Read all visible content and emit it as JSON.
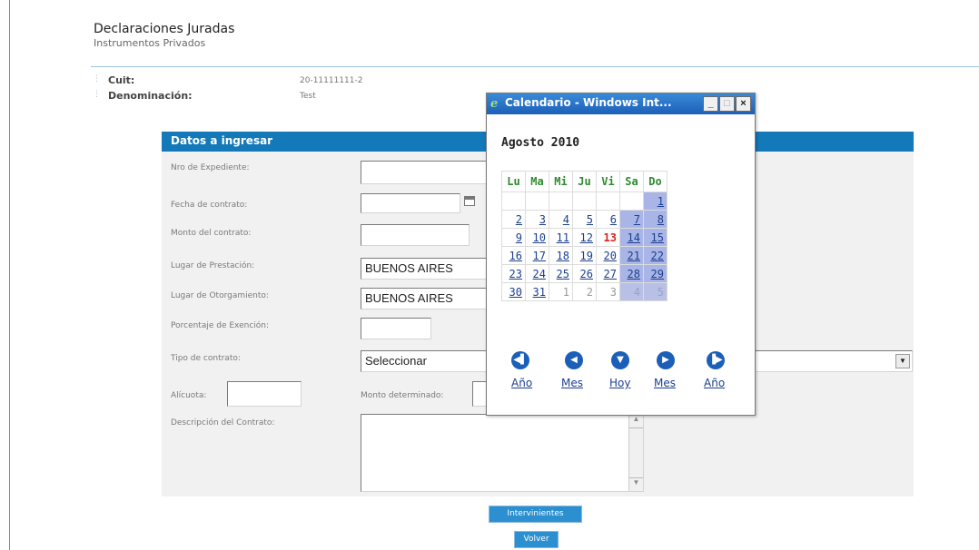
{
  "page": {
    "title": "Declaraciones Juradas",
    "subtitle": "Instrumentos Privados"
  },
  "info": {
    "cuit_label": "Cuit:",
    "cuit_value": "20-11111111-2",
    "denominacion_label": "Denominación:",
    "denominacion_value": "Test"
  },
  "form": {
    "header": "Datos a ingresar",
    "labels": {
      "expediente": "Nro de Expediente:",
      "fecha": "Fecha de contrato:",
      "monto": "Monto del contrato:",
      "lugar_prestacion": "Lugar de Prestación:",
      "lugar_otorgamiento": "Lugar de Otorgamiento:",
      "porcentaje": "Porcentaje de Exención:",
      "tipo": "Tipo de contrato:",
      "alicuota": "Alícuota:",
      "monto_det": "Monto determinado:",
      "descripcion": "Descripción del Contrato:"
    },
    "values": {
      "lugar_prestacion": "BUENOS AIRES",
      "lugar_otorgamiento": "BUENOS AIRES",
      "tipo": "Seleccionar"
    }
  },
  "buttons": {
    "intervinientes": "Intervinientes",
    "volver": "Volver"
  },
  "calendar": {
    "window_title": "Calendario - Windows Int...",
    "month": "Agosto 2010",
    "days": [
      "Lu",
      "Ma",
      "Mi",
      "Ju",
      "Vi",
      "Sa",
      "Do"
    ],
    "weeks": [
      [
        "",
        "",
        "",
        "",
        "",
        "",
        "1"
      ],
      [
        "2",
        "3",
        "4",
        "5",
        "6",
        "7",
        "8"
      ],
      [
        "9",
        "10",
        "11",
        "12",
        "13",
        "14",
        "15"
      ],
      [
        "16",
        "17",
        "18",
        "19",
        "20",
        "21",
        "22"
      ],
      [
        "23",
        "24",
        "25",
        "26",
        "27",
        "28",
        "29"
      ],
      [
        "30",
        "31",
        "1",
        "2",
        "3",
        "4",
        "5"
      ]
    ],
    "today": "13",
    "nav": {
      "prev_year": "Año",
      "prev_month": "Mes",
      "today": "Hoy",
      "next_month": "Mes",
      "next_year": "Año"
    }
  },
  "icons": {
    "window_min": "_",
    "window_max": "□",
    "window_close": "×",
    "select_arrow": "▼"
  }
}
